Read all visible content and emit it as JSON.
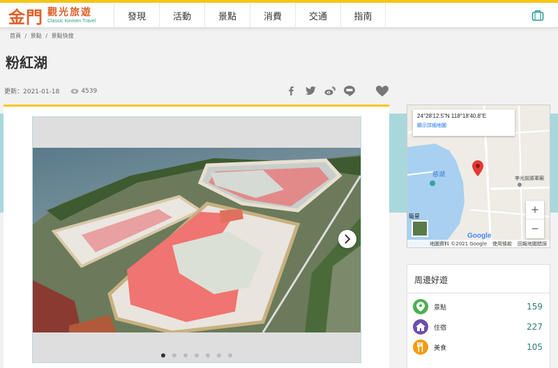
{
  "header": {
    "logo_big": "金門",
    "logo_zh": "觀光旅遊",
    "logo_en": "Classic Kinmen Travel",
    "nav": [
      "發現",
      "活動",
      "景點",
      "消費",
      "交通",
      "指南"
    ]
  },
  "breadcrumb": [
    "首頁",
    "/",
    "景點",
    "/",
    "景點快搜"
  ],
  "page": {
    "title": "粉紅湖",
    "updated": "更新：2021-01-18",
    "views": "4539"
  },
  "gallery": {
    "slides": 7,
    "active": 0
  },
  "map": {
    "coord": "24°28'12.5\"N 118°18'40.8\"E",
    "link": "顯示詳細地圖",
    "lake": "慈湖",
    "place": "李光前將軍廟",
    "thumb_label": "衛星",
    "google": "Google",
    "footer": [
      "地圖資料 ©2021 Google",
      "使用條款",
      "回報地圖錯誤"
    ],
    "zoom_in": "+",
    "zoom_out": "−"
  },
  "nearby": {
    "title": "周邊好遊",
    "items": [
      {
        "label": "景點",
        "count": "159",
        "color": "#4caf50",
        "icon": "map-pin-icon"
      },
      {
        "label": "住宿",
        "count": "227",
        "color": "#6a4fb0",
        "icon": "house-icon"
      },
      {
        "label": "美食",
        "count": "105",
        "color": "#f39c12",
        "icon": "utensils-icon"
      }
    ]
  },
  "colors": {
    "accent": "#f5c518",
    "brand": "#e0602a",
    "teal": "#a9d8dc"
  }
}
